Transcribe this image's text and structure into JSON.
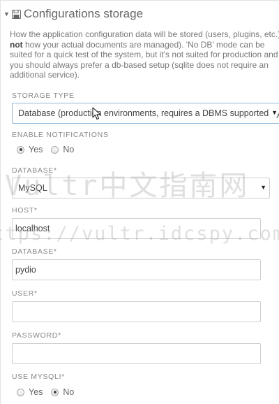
{
  "header": {
    "title": "Configurations storage",
    "icon": "save-icon"
  },
  "intro": {
    "line1": "How the application configuration data will be stored (users, plugins, etc.)",
    "line2_bold": "not",
    "line2_rest": " how your actual documents are managed). 'No DB' mode can be",
    "line3": "suited for a quick test of the system, but it's not suited for production and",
    "line4": "you should always prefer a db-based setup (sqlite does not require an",
    "line5": "additional service)."
  },
  "storage_type": {
    "label": "STORAGE TYPE",
    "value": "Database (production environments, requires a DBMS supported by PHP)"
  },
  "notifications": {
    "label": "ENABLE NOTIFICATIONS",
    "yes": "Yes",
    "no": "No",
    "selected": "yes"
  },
  "database_type": {
    "label": "DATABASE*",
    "value": "MySQL"
  },
  "host": {
    "label": "HOST*",
    "value": "localhost"
  },
  "database_name": {
    "label": "DATABASE*",
    "value": "pydio"
  },
  "user": {
    "label": "USER*",
    "value": ""
  },
  "password": {
    "label": "PASSWORD*",
    "value": ""
  },
  "use_mysqli": {
    "label": "USE MYSQLI*",
    "yes": "Yes",
    "no": "No",
    "selected": "no"
  },
  "watermark": {
    "line1": "Vultr中文指南网",
    "line2": "https://vultr.idcspy.com"
  }
}
